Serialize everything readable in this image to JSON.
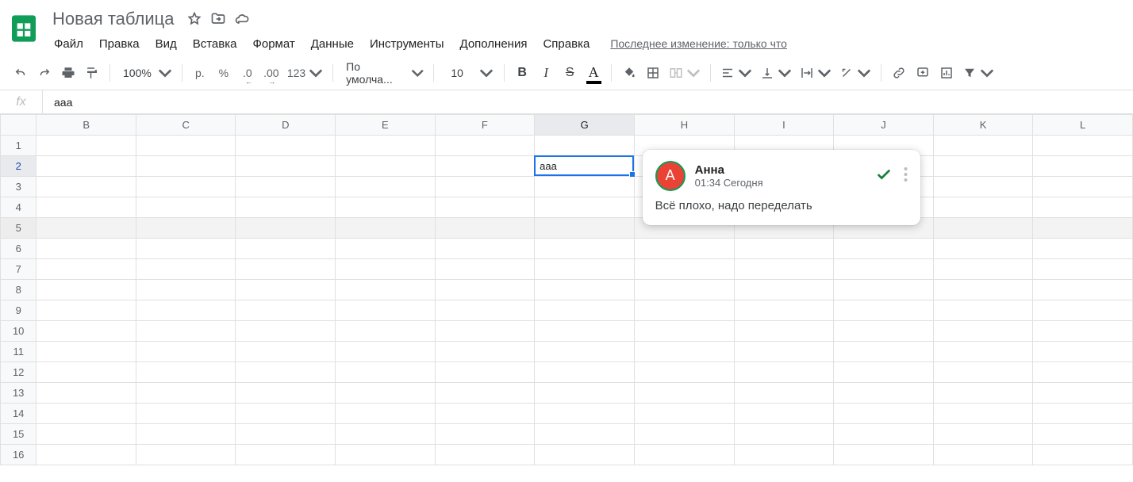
{
  "header": {
    "doc_title": "Новая таблица"
  },
  "menus": [
    "Файл",
    "Правка",
    "Вид",
    "Вставка",
    "Формат",
    "Данные",
    "Инструменты",
    "Дополнения",
    "Справка"
  ],
  "last_edit": "Последнее изменение: только что",
  "toolbar": {
    "zoom": "100%",
    "currency": "р.",
    "percent": "%",
    "dec_less": ".0",
    "dec_more": ".00",
    "fmt": "123",
    "font": "По умолча...",
    "size": "10"
  },
  "formula": {
    "label": "fx",
    "value": "aaa"
  },
  "grid": {
    "columns": [
      "B",
      "C",
      "D",
      "E",
      "F",
      "G",
      "H",
      "I",
      "J",
      "K",
      "L"
    ],
    "rows": [
      "1",
      "2",
      "3",
      "4",
      "5",
      "6",
      "7",
      "8",
      "9",
      "10",
      "11",
      "12",
      "13",
      "14",
      "15",
      "16"
    ],
    "selected_col": "G",
    "selected_row": "2",
    "band_row": "5",
    "cell_value": "aaa"
  },
  "comment": {
    "avatar_letter": "А",
    "name": "Анна",
    "time": "01:34 Сегодня",
    "body": "Всё плохо, надо переделать"
  }
}
